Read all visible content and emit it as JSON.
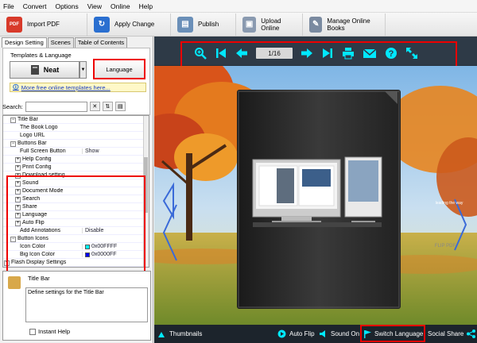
{
  "menu": [
    "File",
    "Convert",
    "Options",
    "View",
    "Online",
    "Help"
  ],
  "toolbar": [
    {
      "label": "Import PDF",
      "icon": "import-pdf-icon",
      "color": "#d83a2a",
      "glyph": "PDF"
    },
    {
      "label": "Apply Change",
      "icon": "apply-change-icon",
      "color": "#2a6fd0",
      "glyph": "↻"
    },
    {
      "label": "Publish",
      "icon": "publish-icon",
      "color": "#6a8fb8",
      "glyph": "▤"
    },
    {
      "label": "Upload Online",
      "icon": "upload-online-icon",
      "color": "#8a9ab0",
      "glyph": "▣"
    },
    {
      "label": "Manage Online Books",
      "icon": "manage-books-icon",
      "color": "#7a8aa0",
      "glyph": "✎"
    }
  ],
  "tabs": [
    "Design Setting",
    "Scenes",
    "Table of Contents"
  ],
  "templates": {
    "group_label": "Templates & Language",
    "template_name": "Neat",
    "language_button": "Language",
    "more_link": "More free online templates here..."
  },
  "search": {
    "label": "Search:"
  },
  "tree": [
    {
      "name": "Title Bar",
      "indent": 0,
      "exp": "−",
      "val": ""
    },
    {
      "name": "The Book Logo",
      "indent": 2,
      "exp": "",
      "val": ""
    },
    {
      "name": "Logo URL",
      "indent": 2,
      "exp": "",
      "val": ""
    },
    {
      "name": "Buttons Bar",
      "indent": 0,
      "exp": "−",
      "val": ""
    },
    {
      "name": "Full Screen Button",
      "indent": 2,
      "exp": "",
      "val": "Show"
    },
    {
      "name": "Help Config",
      "indent": 1,
      "exp": "+",
      "val": ""
    },
    {
      "name": "Print Config",
      "indent": 1,
      "exp": "+",
      "val": ""
    },
    {
      "name": "Download setting",
      "indent": 1,
      "exp": "+",
      "val": ""
    },
    {
      "name": "Sound",
      "indent": 1,
      "exp": "+",
      "val": ""
    },
    {
      "name": "Document Mode",
      "indent": 1,
      "exp": "+",
      "val": ""
    },
    {
      "name": "Search",
      "indent": 1,
      "exp": "+",
      "val": ""
    },
    {
      "name": "Share",
      "indent": 1,
      "exp": "+",
      "val": ""
    },
    {
      "name": "Language",
      "indent": 1,
      "exp": "+",
      "val": ""
    },
    {
      "name": "Auto Flip",
      "indent": 1,
      "exp": "+",
      "val": ""
    },
    {
      "name": "Add Annotations",
      "indent": 2,
      "exp": "",
      "val": "Disable"
    },
    {
      "name": "Button Icons",
      "indent": 0,
      "exp": "−",
      "val": ""
    },
    {
      "name": "Icon Color",
      "indent": 2,
      "exp": "",
      "val": "0x00FFFF",
      "swatch": "#00ffff"
    },
    {
      "name": "Big Icon Color",
      "indent": 2,
      "exp": "",
      "val": "0x0000FF",
      "swatch": "#0000ff"
    },
    {
      "name": "Flash Display Settings",
      "indent": -1,
      "exp": "+",
      "val": ""
    }
  ],
  "description": {
    "title": "Title Bar",
    "text": "Define settings for the Title Bar",
    "instant_help": "Instant Help"
  },
  "viewer": {
    "page_indicator": "1/16",
    "cover_text": "FLIP PDF",
    "thumb_text": "leading the way",
    "bottom": {
      "thumbnails": "Thumbnails",
      "auto_flip": "Auto Flip",
      "sound_on": "Sound On",
      "switch_language": "Switch Language",
      "social_share": "Social Share"
    }
  },
  "colors": {
    "highlight": "#ff0000",
    "viewer_bg": "#25303b",
    "icon_color": "#00ffff"
  }
}
